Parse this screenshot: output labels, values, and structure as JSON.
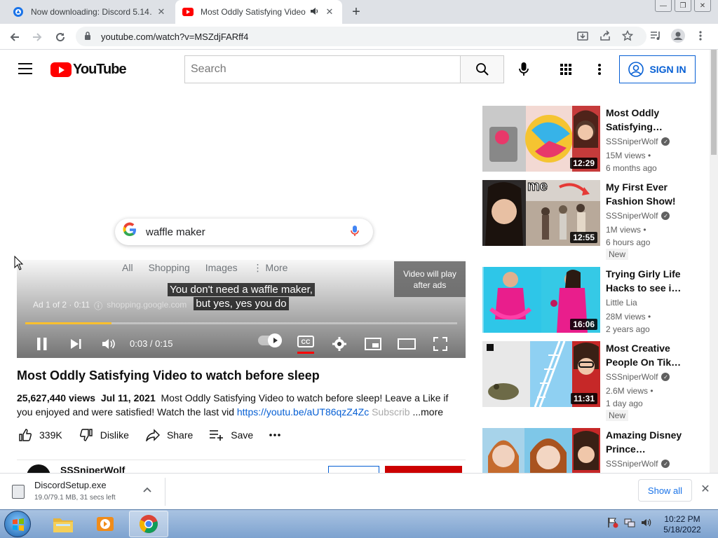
{
  "browser": {
    "tabs": [
      {
        "title": "Now downloading: Discord 5.14…",
        "close": "✕"
      },
      {
        "title": "Most Oddly Satisfying Video",
        "close": "✕"
      }
    ],
    "new_tab": "+",
    "url": "youtube.com/watch?v=MSZdjFARff4"
  },
  "youtube": {
    "logo_text": "YouTube",
    "search_placeholder": "Search",
    "sign_in": "SIGN IN"
  },
  "player": {
    "google_query": "waffle maker",
    "google_tabs": [
      "All",
      "Shopping",
      "Images",
      "⋮ More"
    ],
    "skip_text": "Video will play after ads",
    "caption_lines": [
      "You don't need a waffle maker,",
      "but yes, yes you do"
    ],
    "ad_label": "Ad 1 of 2 · 0:11",
    "ad_site": "shopping.google.com",
    "time": "0:03 / 0:15",
    "progress_fraction": 0.2,
    "colors": {
      "progress": "#fbc02d",
      "cc_underline": "#ff0000"
    }
  },
  "video": {
    "title": "Most Oddly Satisfying Video to watch before sleep",
    "views": "25,627,440 views",
    "date": "Jul 11, 2021",
    "description": "Most Oddly Satisfying Video to watch before sleep! Leave a Like if you enjoyed and were satisfied! Watch the last vid",
    "link": "https://youtu.be/aUT86qzZ4Zc",
    "desc_tail": "Subscrib",
    "more": "...more",
    "likes": "339K",
    "dislike": "Dislike",
    "share": "Share",
    "save": "Save",
    "channel": "SSSniperWolf"
  },
  "related": [
    {
      "title": "Most Oddly Satisfying…",
      "channel": "SSSniperWolf",
      "verified": true,
      "views": "15M views •",
      "age": "6 months ago",
      "duration": "12:29",
      "badge": ""
    },
    {
      "title": "My First Ever Fashion Show!",
      "channel": "SSSniperWolf",
      "verified": true,
      "views": "1M views •",
      "age": "6 hours ago",
      "duration": "12:55",
      "badge": "New",
      "thumb_text": "me"
    },
    {
      "title": "Trying Girly Life Hacks to see i…",
      "channel": "Little Lia",
      "verified": false,
      "views": "28M views •",
      "age": "2 years ago",
      "duration": "16:06",
      "badge": ""
    },
    {
      "title": "Most Creative People On Tik…",
      "channel": "SSSniperWolf",
      "verified": true,
      "views": "2.6M views •",
      "age": "1 day ago",
      "duration": "11:31",
      "badge": "New"
    },
    {
      "title": "Amazing Disney Prince…",
      "channel": "SSSniperWolf",
      "verified": true,
      "views": "",
      "age": "",
      "duration": "",
      "badge": ""
    }
  ],
  "download": {
    "filename": "DiscordSetup.exe",
    "status": "19.0/79.1 MB, 31 secs left",
    "show_all": "Show all"
  },
  "taskbar": {
    "time": "10:22 PM",
    "date": "5/18/2022"
  }
}
